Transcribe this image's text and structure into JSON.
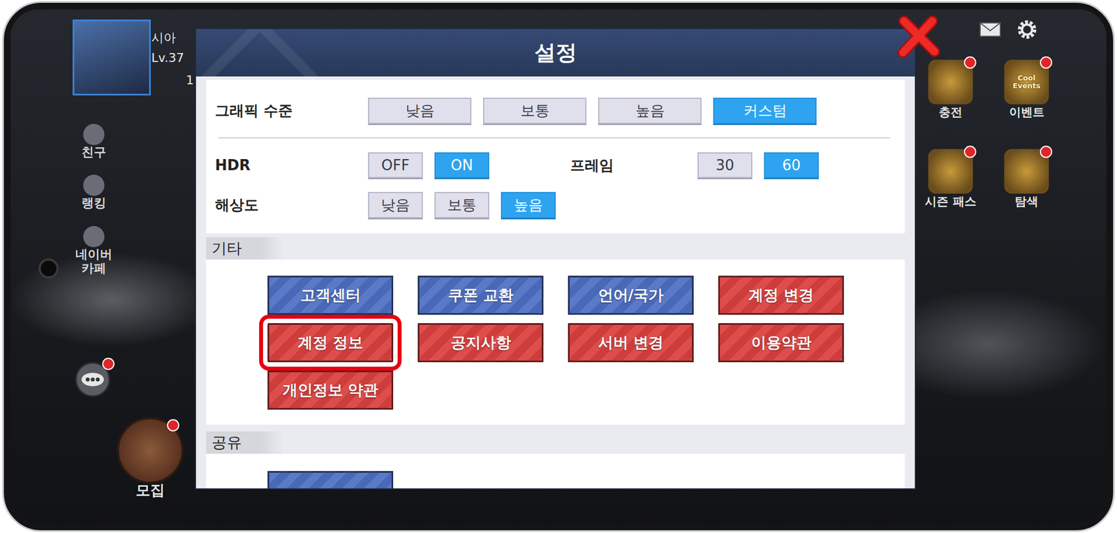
{
  "hud": {
    "player_name": "시아",
    "level": "Lv.37",
    "stat": "1"
  },
  "side_menu": [
    {
      "label": "친구"
    },
    {
      "label": "랭킹"
    },
    {
      "label": "네이버 카페"
    }
  ],
  "right_menu": [
    {
      "label": "충전",
      "badge": true,
      "icon_text": ""
    },
    {
      "label": "이벤트",
      "badge": true,
      "icon_text": "Cool Events"
    },
    {
      "label": "시즌 패스",
      "badge": true,
      "icon_text": ""
    },
    {
      "label": "탐색",
      "badge": true,
      "icon_text": ""
    }
  ],
  "recruit": {
    "label": "모집",
    "badge": true
  },
  "chat": {
    "badge": true
  },
  "dialog": {
    "title": "설정",
    "graphics": {
      "label": "그래픽 수준",
      "options": [
        {
          "label": "낮음",
          "selected": false
        },
        {
          "label": "보통",
          "selected": false
        },
        {
          "label": "높음",
          "selected": false
        },
        {
          "label": "커스텀",
          "selected": true
        }
      ]
    },
    "hdr": {
      "label": "HDR",
      "options": [
        {
          "label": "OFF",
          "selected": false
        },
        {
          "label": "ON",
          "selected": true
        }
      ]
    },
    "frame": {
      "label": "프레임",
      "options": [
        {
          "label": "30",
          "selected": false
        },
        {
          "label": "60",
          "selected": true
        }
      ]
    },
    "resolution": {
      "label": "해상도",
      "options": [
        {
          "label": "낮음",
          "selected": false
        },
        {
          "label": "보통",
          "selected": false
        },
        {
          "label": "높음",
          "selected": true
        }
      ]
    },
    "misc": {
      "title": "기타",
      "buttons": [
        {
          "label": "고객센터",
          "color": "#4d6fc2",
          "highlighted": false
        },
        {
          "label": "쿠폰 교환",
          "color": "#4d6fc2",
          "highlighted": false
        },
        {
          "label": "언어/국가",
          "color": "#4d6fc2",
          "highlighted": false
        },
        {
          "label": "계정 변경",
          "color": "#d9403e",
          "highlighted": false
        },
        {
          "label": "계정 정보",
          "color": "#d9403e",
          "highlighted": true
        },
        {
          "label": "공지사항",
          "color": "#d9403e",
          "highlighted": false
        },
        {
          "label": "서버 변경",
          "color": "#d9403e",
          "highlighted": false
        },
        {
          "label": "이용약관",
          "color": "#d9403e",
          "highlighted": false
        },
        {
          "label": "개인정보 약관",
          "color": "#d9403e",
          "highlighted": false
        }
      ]
    },
    "share": {
      "title": "공유",
      "buttons": [
        {
          "color": "#4d6fc2"
        }
      ]
    }
  }
}
